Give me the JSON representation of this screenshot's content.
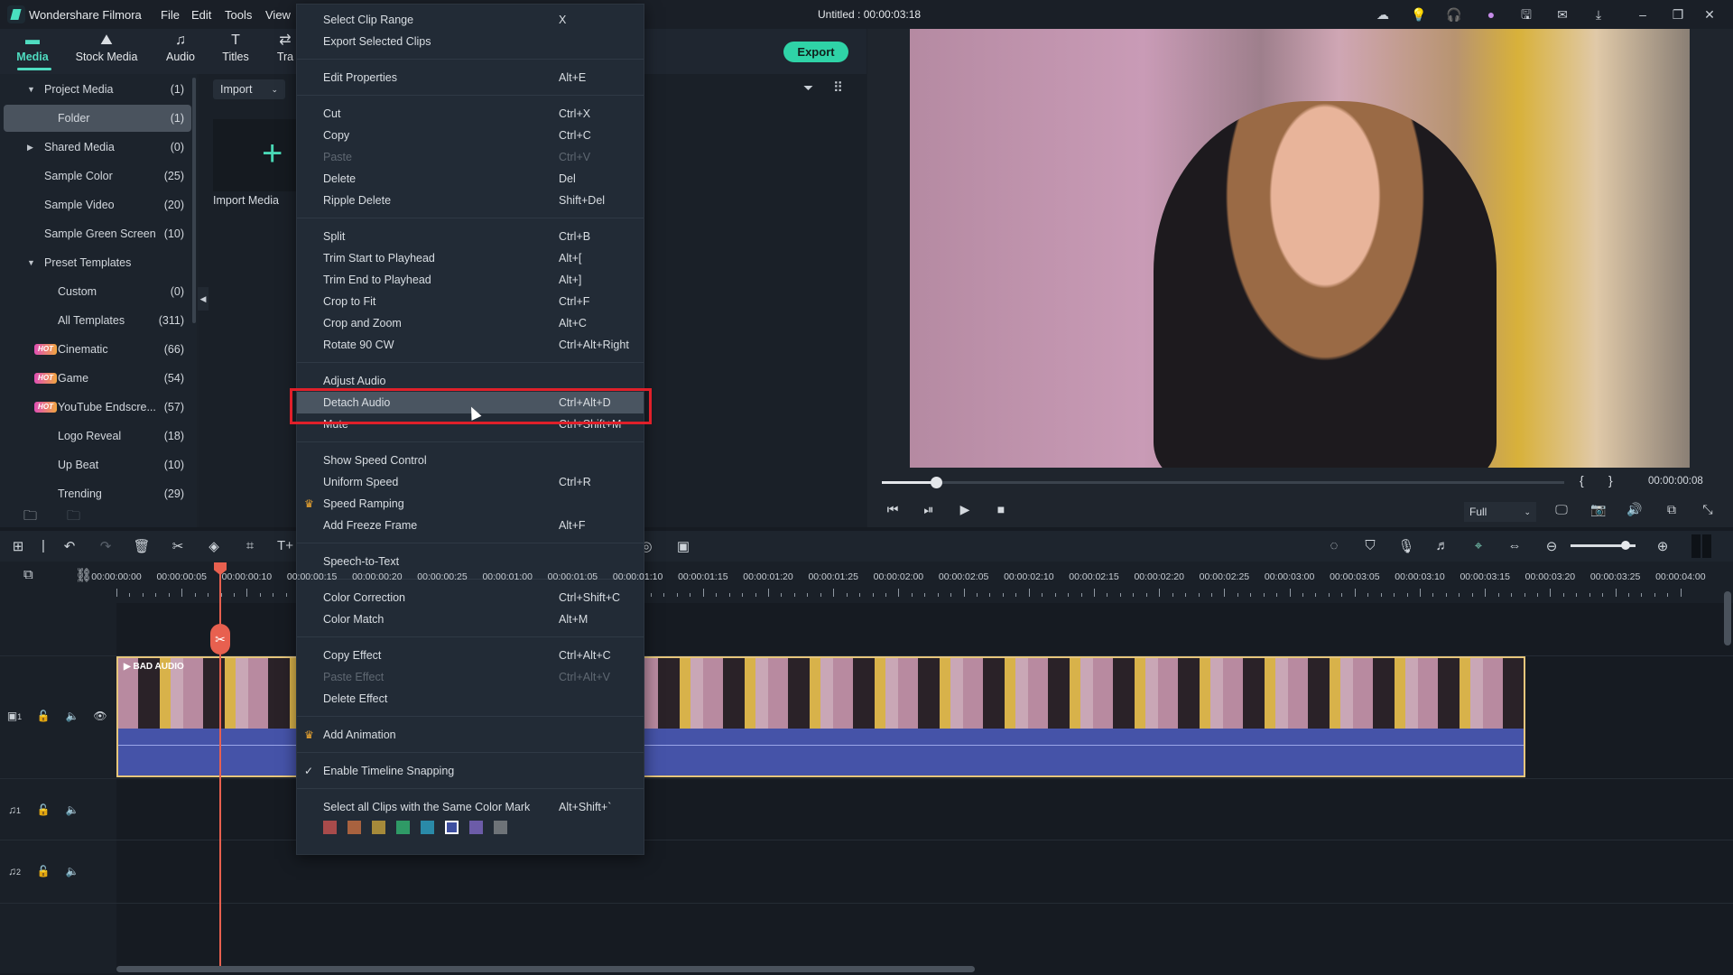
{
  "app": {
    "name": "Wondershare Filmora",
    "project_title": "Untitled : 00:00:03:18",
    "menubar": [
      "File",
      "Edit",
      "Tools",
      "View"
    ],
    "export_label": "Export",
    "title_icons": [
      "cloud-icon",
      "lightbulb-icon",
      "headset-icon",
      "avatar-icon",
      "save-icon",
      "mail-icon",
      "download-icon",
      "minimize-icon",
      "restore-icon",
      "close-icon"
    ]
  },
  "tabs": [
    {
      "label": "Media",
      "icon": "folder-icon",
      "active": true
    },
    {
      "label": "Stock Media",
      "icon": "cloud-image-icon"
    },
    {
      "label": "Audio",
      "icon": "music-note-icon"
    },
    {
      "label": "Titles",
      "icon": "text-icon"
    },
    {
      "label": "Tra",
      "icon": "transition-icon"
    }
  ],
  "sidebar": [
    {
      "label": "Project Media",
      "count": "(1)",
      "arrow": "down",
      "indent": 0
    },
    {
      "label": "Folder",
      "count": "(1)",
      "indent": 1,
      "selected": true
    },
    {
      "label": "Shared Media",
      "count": "(0)",
      "arrow": "right",
      "indent": 0
    },
    {
      "label": "Sample Color",
      "count": "(25)",
      "indent": 0
    },
    {
      "label": "Sample Video",
      "count": "(20)",
      "indent": 0
    },
    {
      "label": "Sample Green Screen",
      "count": "(10)",
      "indent": 0
    },
    {
      "label": "Preset Templates",
      "count": "",
      "arrow": "down",
      "indent": 0
    },
    {
      "label": "Custom",
      "count": "(0)",
      "indent": 1
    },
    {
      "label": "All Templates",
      "count": "(311)",
      "indent": 1
    },
    {
      "label": "Cinematic",
      "count": "(66)",
      "indent": 1,
      "hot": "HOT"
    },
    {
      "label": "Game",
      "count": "(54)",
      "indent": 1,
      "hot": "HOT"
    },
    {
      "label": "YouTube Endscre...",
      "count": "(57)",
      "indent": 1,
      "hot": "HOT"
    },
    {
      "label": "Logo Reveal",
      "count": "(18)",
      "indent": 1
    },
    {
      "label": "Up Beat",
      "count": "(10)",
      "indent": 1
    },
    {
      "label": "Trending",
      "count": "(29)",
      "indent": 1
    }
  ],
  "media": {
    "import_label": "Import",
    "import_media_label": "Import Media"
  },
  "preview": {
    "timecode": "00:00:00:08",
    "progress": 0.08,
    "quality": "Full",
    "mark_in": "{",
    "mark_out": "}"
  },
  "timeline": {
    "ruler": [
      "00:00:00:00",
      "00:00:00:05",
      "00:00:00:10",
      "00:00:00:15",
      "00:00:00:20",
      "00:00:00:25",
      "00:00:01:00",
      "00:00:01:05",
      "00:00:01:10",
      "00:00:01:15",
      "00:00:01:20",
      "00:00:01:25",
      "00:00:02:00",
      "00:00:02:05",
      "00:00:02:10",
      "00:00:02:15",
      "00:00:02:20",
      "00:00:02:25",
      "00:00:03:00",
      "00:00:03:05",
      "00:00:03:10",
      "00:00:03:15",
      "00:00:03:20",
      "00:00:03:25",
      "00:00:04:00"
    ],
    "clip_label": "BAD AUDIO",
    "video_track": "1",
    "audio_tracks": [
      "1",
      "2"
    ],
    "zoom_level": 0.85
  },
  "context_menu": [
    {
      "label": "Select Clip Range",
      "shortcut": "X"
    },
    {
      "label": "Export Selected Clips",
      "shortcut": ""
    },
    {
      "sep": true
    },
    {
      "label": "Edit Properties",
      "shortcut": "Alt+E"
    },
    {
      "sep": true
    },
    {
      "label": "Cut",
      "shortcut": "Ctrl+X"
    },
    {
      "label": "Copy",
      "shortcut": "Ctrl+C"
    },
    {
      "label": "Paste",
      "shortcut": "Ctrl+V",
      "disabled": true
    },
    {
      "label": "Delete",
      "shortcut": "Del"
    },
    {
      "label": "Ripple Delete",
      "shortcut": "Shift+Del"
    },
    {
      "sep": true
    },
    {
      "label": "Split",
      "shortcut": "Ctrl+B"
    },
    {
      "label": "Trim Start to Playhead",
      "shortcut": "Alt+["
    },
    {
      "label": "Trim End to Playhead",
      "shortcut": "Alt+]"
    },
    {
      "label": "Crop to Fit",
      "shortcut": "Ctrl+F"
    },
    {
      "label": "Crop and Zoom",
      "shortcut": "Alt+C"
    },
    {
      "label": "Rotate 90 CW",
      "shortcut": "Ctrl+Alt+Right"
    },
    {
      "sep": true
    },
    {
      "label": "Adjust Audio",
      "shortcut": ""
    },
    {
      "label": "Detach Audio",
      "shortcut": "Ctrl+Alt+D",
      "highlighted": true
    },
    {
      "label": "Mute",
      "shortcut": "Ctrl+Shift+M"
    },
    {
      "sep": true
    },
    {
      "label": "Show Speed Control",
      "shortcut": ""
    },
    {
      "label": "Uniform Speed",
      "shortcut": "Ctrl+R"
    },
    {
      "label": "Speed Ramping",
      "shortcut": "",
      "premium": true
    },
    {
      "label": "Add Freeze Frame",
      "shortcut": "Alt+F"
    },
    {
      "sep": true
    },
    {
      "label": "Speech-to-Text",
      "shortcut": ""
    },
    {
      "sep": true
    },
    {
      "label": "Color Correction",
      "shortcut": "Ctrl+Shift+C"
    },
    {
      "label": "Color Match",
      "shortcut": "Alt+M"
    },
    {
      "sep": true
    },
    {
      "label": "Copy Effect",
      "shortcut": "Ctrl+Alt+C"
    },
    {
      "label": "Paste Effect",
      "shortcut": "Ctrl+Alt+V",
      "disabled": true
    },
    {
      "label": "Delete Effect",
      "shortcut": ""
    },
    {
      "sep": true
    },
    {
      "label": "Add Animation",
      "shortcut": "",
      "premium": true
    },
    {
      "sep": true
    },
    {
      "label": "Enable Timeline Snapping",
      "shortcut": "",
      "checked": true
    },
    {
      "sep": true
    },
    {
      "label": "Select all Clips with the Same Color Mark",
      "shortcut": "Alt+Shift+`"
    }
  ],
  "color_marks": [
    "#a84b4b",
    "#a8623f",
    "#a68a3a",
    "#2f9a66",
    "#2a8aa8",
    "#3e4fa0",
    "#6c5ca8",
    "#6e7378"
  ],
  "selected_color_mark": 5,
  "colors": {
    "accent": "#4fdcc0",
    "export": "#2fd3a7",
    "highlight_box": "#e0202a",
    "playhead": "#e8604f",
    "clip_border": "#e6c67c"
  }
}
